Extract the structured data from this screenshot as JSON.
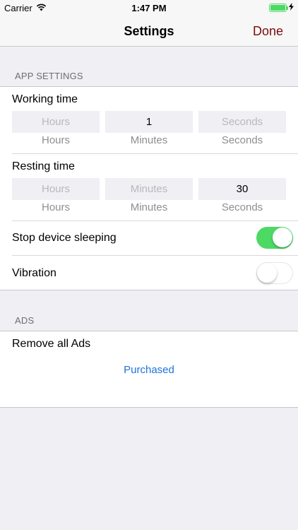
{
  "status_bar": {
    "carrier": "Carrier",
    "time": "1:47 PM",
    "battery_color": "#4cd964"
  },
  "nav": {
    "title": "Settings",
    "done_label": "Done",
    "done_color": "#7b0c0c"
  },
  "app_settings": {
    "header": "APP SETTINGS",
    "working_time": {
      "label": "Working time",
      "fields": [
        {
          "value": "",
          "placeholder": "Hours",
          "unit": "Hours"
        },
        {
          "value": "1",
          "placeholder": "Minutes",
          "unit": "Minutes"
        },
        {
          "value": "",
          "placeholder": "Seconds",
          "unit": "Seconds"
        }
      ]
    },
    "resting_time": {
      "label": "Resting time",
      "fields": [
        {
          "value": "",
          "placeholder": "Hours",
          "unit": "Hours"
        },
        {
          "value": "",
          "placeholder": "Minutes",
          "unit": "Minutes"
        },
        {
          "value": "30",
          "placeholder": "Seconds",
          "unit": "Seconds"
        }
      ]
    },
    "stop_sleeping": {
      "label": "Stop device sleeping",
      "on": true
    },
    "vibration": {
      "label": "Vibration",
      "on": false
    }
  },
  "ads": {
    "header": "ADS",
    "remove_label": "Remove all Ads",
    "status": "Purchased"
  }
}
